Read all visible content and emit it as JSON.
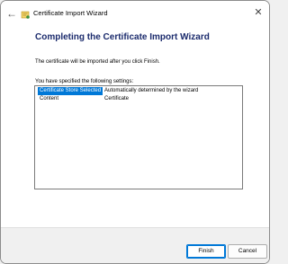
{
  "window": {
    "title": "Certificate Import Wizard"
  },
  "wizard": {
    "heading": "Completing the Certificate Import Wizard",
    "intro": "The certificate will be imported after you click Finish.",
    "settings_label": "You have specified the following settings:",
    "settings": [
      {
        "key": "Certificate Store Selected",
        "value": "Automatically determined by the wizard"
      },
      {
        "key": "Content",
        "value": "Certificate"
      }
    ]
  },
  "footer": {
    "finish_label": "Finish",
    "cancel_label": "Cancel"
  },
  "icons": {
    "back": "back-arrow-icon",
    "app": "certificate-icon",
    "close": "close-icon"
  },
  "colors": {
    "heading": "#1a2a6c",
    "selection": "#0078d7"
  }
}
